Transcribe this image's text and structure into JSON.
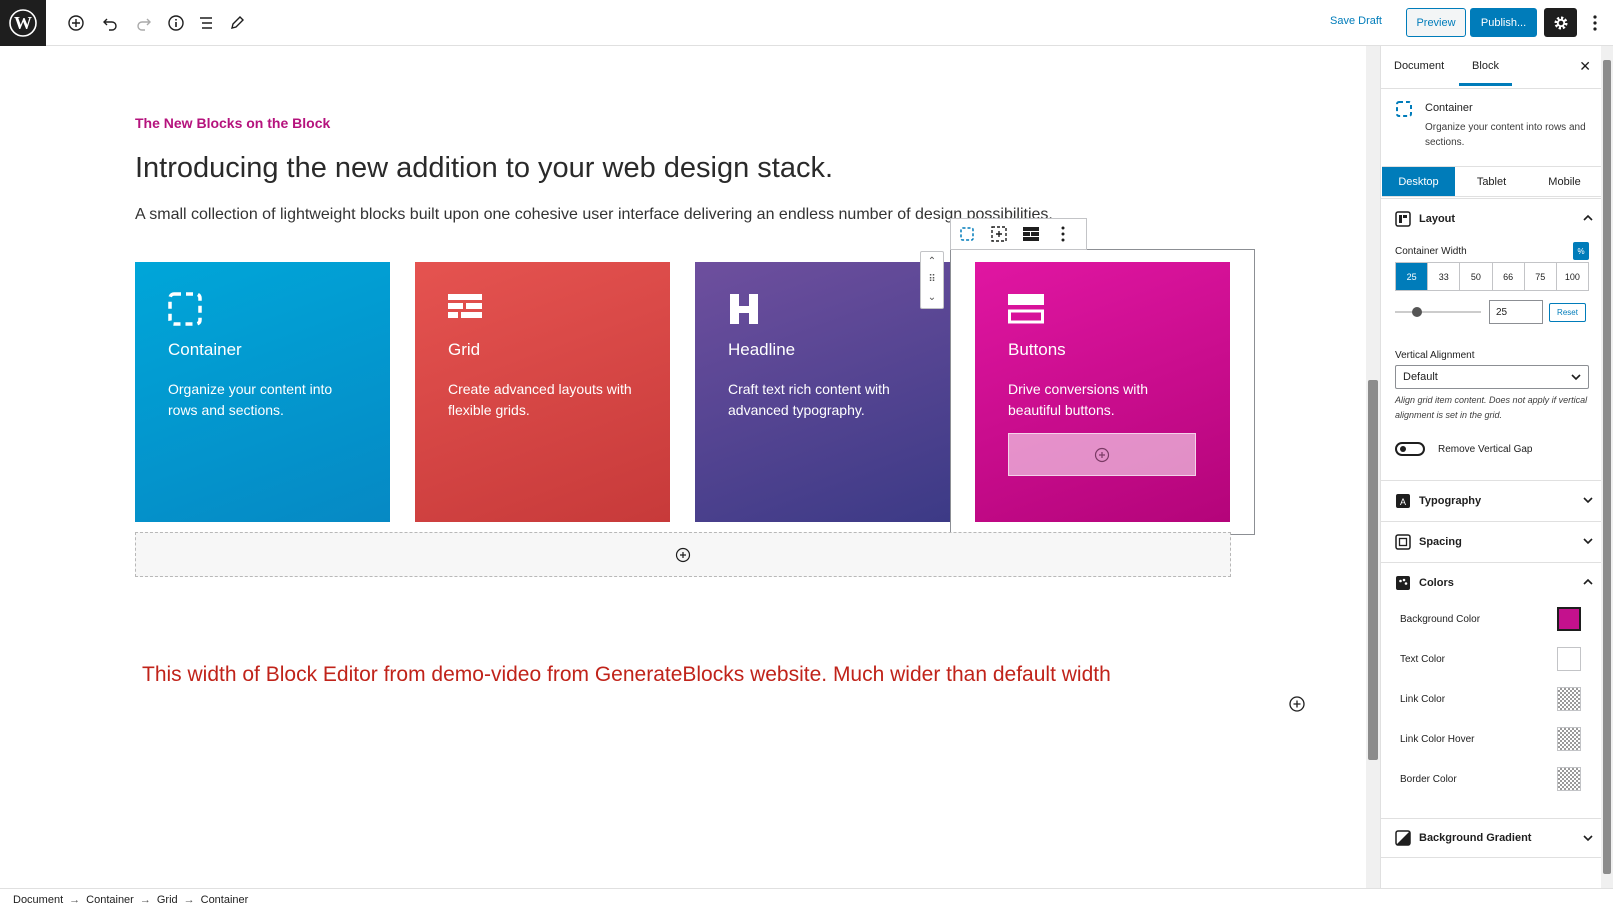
{
  "toolbar": {
    "save_draft_label": "Save Draft",
    "preview_label": "Preview",
    "publish_label": "Publish...",
    "icons": [
      "wordpress-logo",
      "add-block-icon",
      "undo-icon",
      "redo-icon",
      "info-icon",
      "list-view-icon",
      "tools-icon",
      "gear-icon",
      "more-vertical-icon"
    ]
  },
  "content": {
    "eyebrow": "The New Blocks on the Block",
    "heading": "Introducing the new addition to your web design stack.",
    "lead": "A small collection of lightweight blocks built upon one cohesive user interface delivering an endless number of design possibilities.",
    "cards": [
      {
        "title": "Container",
        "text": "Organize your content into rows and sections.",
        "icon": "container-icon",
        "color": "#00a6d9"
      },
      {
        "title": "Grid",
        "text": "Create advanced layouts with flexible grids.",
        "icon": "grid-icon",
        "color": "#e55350"
      },
      {
        "title": "Headline",
        "text": "Craft text rich content with advanced typography.",
        "icon": "headline-icon",
        "color": "#5a4595"
      },
      {
        "title": "Buttons",
        "text": "Drive conversions with beautiful buttons.",
        "icon": "buttons-icon",
        "color": "#d4118f"
      }
    ],
    "note": "This width of Block Editor from demo-video from GenerateBlocks website. Much wider than default width"
  },
  "sidebar": {
    "tabs": [
      "Document",
      "Block"
    ],
    "active_tab": "Block",
    "block": {
      "title": "Container",
      "description": "Organize your content into rows and sections."
    },
    "devices": [
      "Desktop",
      "Tablet",
      "Mobile"
    ],
    "active_device": "Desktop",
    "layout": {
      "title": "Layout",
      "container_width_label": "Container Width",
      "unit": "%",
      "width_options": [
        "25",
        "33",
        "50",
        "66",
        "75",
        "100"
      ],
      "selected_width": "25",
      "width_value": "25",
      "slider_fraction": 0.25,
      "reset_label": "Reset",
      "vertical_alignment_label": "Vertical Alignment",
      "vertical_alignment_value": "Default",
      "help_text": "Align grid item content. Does not apply if vertical alignment is set in the grid.",
      "remove_gap_label": "Remove Vertical Gap"
    },
    "panels": {
      "typography": "Typography",
      "spacing": "Spacing",
      "colors": "Colors",
      "background_gradient": "Background Gradient"
    },
    "colors": [
      {
        "label": "Background Color",
        "value": "#c4118d"
      },
      {
        "label": "Text Color",
        "value": "#ffffff"
      },
      {
        "label": "Link Color",
        "value": "transparent"
      },
      {
        "label": "Link Color Hover",
        "value": "transparent"
      },
      {
        "label": "Border Color",
        "value": "transparent"
      }
    ]
  },
  "breadcrumb": [
    "Document",
    "Container",
    "Grid",
    "Container"
  ]
}
